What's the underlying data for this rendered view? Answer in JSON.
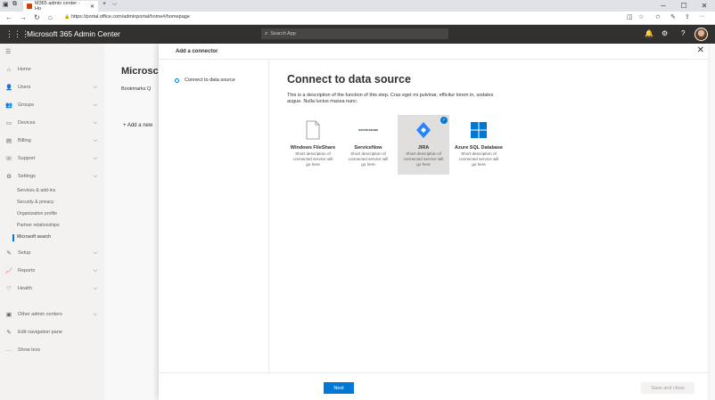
{
  "browser": {
    "tab_title": "M365 admin center - Ho",
    "tab_close": "✕",
    "new_tab": "+",
    "tab_menu": "⌵",
    "url": "https://portal.office.com/adminportal/home#/homepage",
    "back": "←",
    "forward": "→",
    "refresh": "↻",
    "home": "⌂",
    "lock": "🔒",
    "window_controls": {
      "minimize": "─",
      "maximize": "☐",
      "close": "✕"
    },
    "toolbar_icons": {
      "reading": "◫",
      "favorite": "☆",
      "favorites": "✩",
      "pen": "✎",
      "share": "⇪",
      "more": "···"
    }
  },
  "header": {
    "waffle": "⋮⋮⋮",
    "title": "Microsoft 365 Admin Center",
    "search_placeholder": "Search App",
    "search_icon": "⌕",
    "bell": "🔔",
    "gear": "⚙",
    "help": "?"
  },
  "nav": {
    "hamburger": "☰",
    "items": [
      {
        "label": "Home",
        "icon": "⌂"
      },
      {
        "label": "Users",
        "icon": "👤",
        "chev": "⌵"
      },
      {
        "label": "Groups",
        "icon": "👥",
        "chev": "⌵"
      },
      {
        "label": "Devices",
        "icon": "▭",
        "chev": "⌵"
      },
      {
        "label": "Billing",
        "icon": "▤",
        "chev": "⌵"
      },
      {
        "label": "Support",
        "icon": "☏",
        "chev": "⌵"
      },
      {
        "label": "Settings",
        "icon": "⚙",
        "chev": "⌵"
      }
    ],
    "sub_items": [
      "Services & add-ins",
      "Security & privacy",
      "Organization profile",
      "Partner relationships",
      "Microsoft search"
    ],
    "items2": [
      {
        "label": "Setup",
        "icon": "✎",
        "chev": "⌵"
      },
      {
        "label": "Reports",
        "icon": "📈",
        "chev": "⌵"
      },
      {
        "label": "Health",
        "icon": "♡",
        "chev": "⌵"
      }
    ],
    "items3": [
      {
        "label": "Other admin centers",
        "icon": "▣",
        "chev": "⌵"
      },
      {
        "label": "Edit navigation pane",
        "icon": "✎"
      },
      {
        "label": "Show less",
        "icon": "···"
      }
    ]
  },
  "background": {
    "title": "Microsc",
    "tabs": "Bookmarks   Q",
    "add_link": "Add a new"
  },
  "panel": {
    "title": "Add a connector",
    "close": "✕",
    "step_label": "Connect to data source",
    "content_title": "Connect to data source",
    "description": "This is a description of the function of this step. Cras eget mi pulvinar, efficitur lorem in, sodales augue. Nulla luctus massa nunc.",
    "tiles": [
      {
        "name": "Windows FileShare",
        "desc": "Short description of connected service will go here",
        "selected": false
      },
      {
        "name": "ServiceNow",
        "logo_text": "servicenow",
        "desc": "Short description of connected service will go here",
        "selected": false
      },
      {
        "name": "JIRA",
        "desc": "Short description of connected service will go here",
        "selected": true
      },
      {
        "name": "Azure SQL Database",
        "desc": "Short description of connected service will go here",
        "selected": false
      }
    ],
    "check": "✓",
    "next_label": "Next",
    "save_label": "Save and close"
  },
  "colors": {
    "accent": "#0078d4",
    "header": "#323130",
    "jira": "#2684ff",
    "office": "#d83b01"
  }
}
